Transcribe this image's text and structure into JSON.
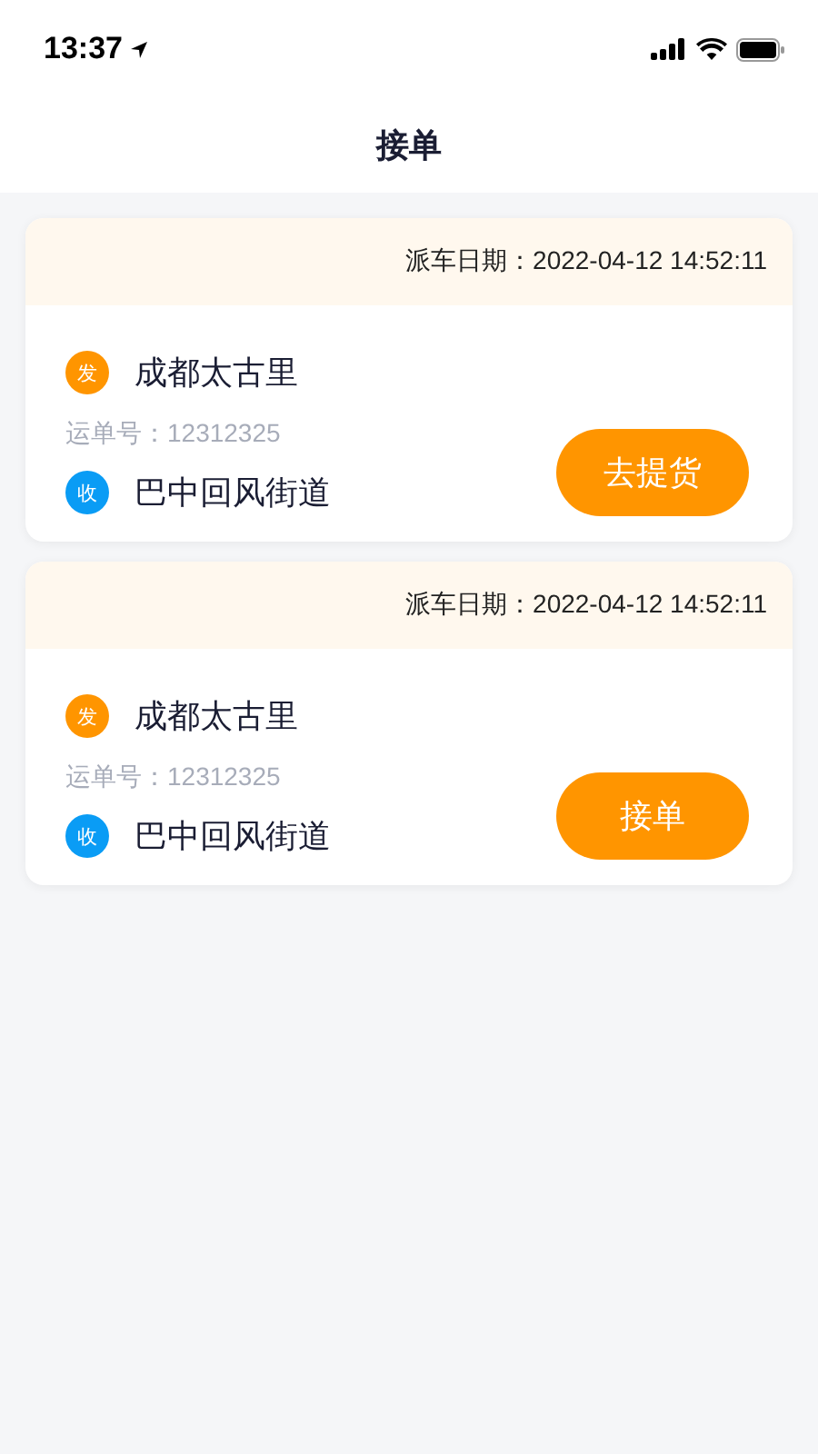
{
  "status_bar": {
    "time": "13:37"
  },
  "nav": {
    "title": "接单"
  },
  "orders": [
    {
      "dispatch": "派车日期：2022-04-12 14:52:11",
      "stops": [
        {
          "badge": "发",
          "color": "#ff9500",
          "place": "成都太古里"
        },
        {
          "badge": "收",
          "color": "#0a9cf5",
          "place": "巴中回风街道"
        }
      ],
      "waybill": "运单号：12312325",
      "action": "去提货"
    },
    {
      "dispatch": "派车日期：2022-04-12 14:52:11",
      "stops": [
        {
          "badge": "发",
          "color": "#ff9500",
          "place": "成都太古里"
        },
        {
          "badge": "收",
          "color": "#0a9cf5",
          "place": "巴中回风街道"
        }
      ],
      "waybill": "运单号：12312325",
      "action": "接单"
    }
  ]
}
